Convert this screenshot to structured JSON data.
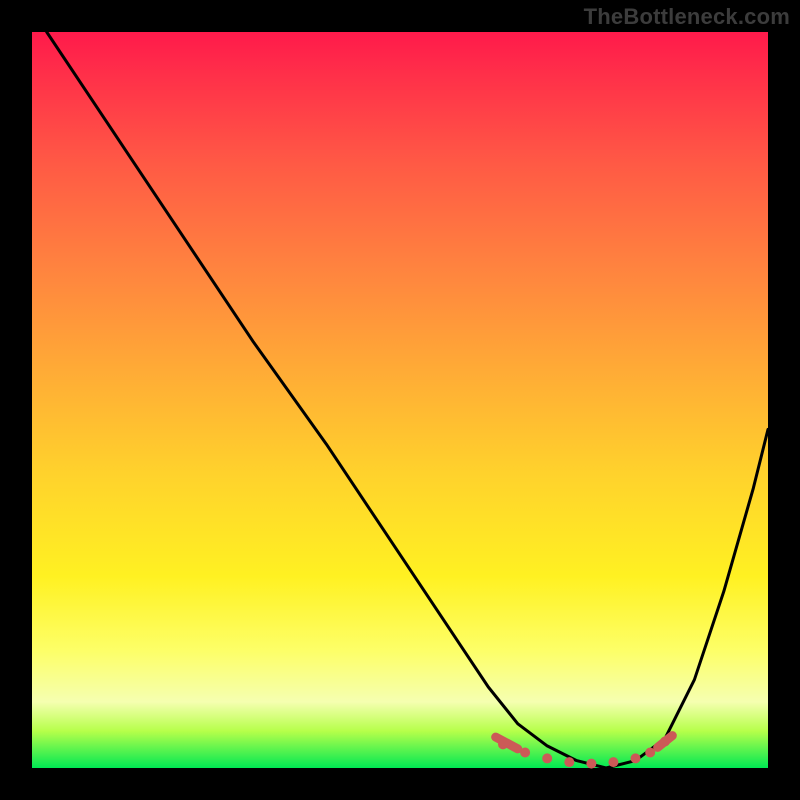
{
  "watermark": "TheBottleneck.com",
  "colors": {
    "background": "#000000",
    "gradient_top": "#ff1a4b",
    "gradient_mid": "#ffd22c",
    "gradient_bottom": "#00e853",
    "curve": "#000000",
    "marker": "#cc5a57"
  },
  "chart_data": {
    "type": "line",
    "title": "",
    "xlabel": "",
    "ylabel": "",
    "xlim": [
      0,
      100
    ],
    "ylim": [
      0,
      100
    ],
    "series": [
      {
        "name": "bottleneck-curve",
        "x": [
          2,
          10,
          20,
          30,
          40,
          50,
          58,
          62,
          66,
          70,
          74,
          78,
          82,
          86,
          90,
          94,
          98,
          100
        ],
        "values": [
          100,
          88,
          73,
          58,
          44,
          29,
          17,
          11,
          6,
          3,
          1,
          0,
          1,
          4,
          12,
          24,
          38,
          46
        ]
      }
    ],
    "annotations": [
      {
        "name": "trough-dotted-band",
        "x": [
          64,
          67,
          70,
          73,
          76,
          79,
          82,
          84,
          86
        ],
        "values": [
          3.2,
          2.1,
          1.3,
          0.8,
          0.6,
          0.8,
          1.3,
          2.1,
          3.6
        ]
      }
    ]
  }
}
